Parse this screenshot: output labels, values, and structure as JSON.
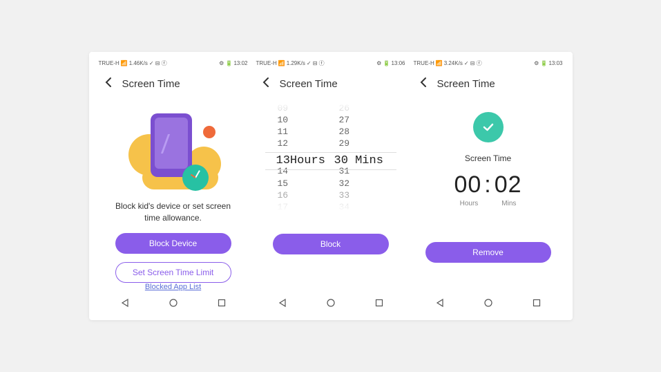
{
  "colors": {
    "primary": "#8a5dea",
    "accent": "#3cc8aa",
    "orange": "#ef6a3a",
    "yellow": "#f6c24a"
  },
  "screens": [
    {
      "status": {
        "carrier": "TRUE-H",
        "speed": "1.46K/s",
        "time": "13:02"
      },
      "header": "Screen Time",
      "body": {
        "description": "Block kid's device or set screen time allowance.",
        "primary_label": "Block Device",
        "secondary_label": "Set Screen Time Limit",
        "link_label": "Blocked App List"
      }
    },
    {
      "status": {
        "carrier": "TRUE-H",
        "speed": "1.29K/s",
        "time": "13:06"
      },
      "header": "Screen Time",
      "body": {
        "picker": {
          "hours_visible": [
            "09",
            "10",
            "11",
            "12",
            "13",
            "14",
            "15",
            "16",
            "17"
          ],
          "mins_visible": [
            "26",
            "27",
            "28",
            "29",
            "30",
            "31",
            "32",
            "33",
            "34"
          ],
          "hours_selected": "13",
          "mins_selected": "30",
          "hours_unit": "Hours",
          "mins_unit": "Mins"
        },
        "primary_label": "Block"
      }
    },
    {
      "status": {
        "carrier": "TRUE-H",
        "speed": "3.24K/s",
        "time": "13:03"
      },
      "header": "Screen Time",
      "body": {
        "title": "Screen Time",
        "hours_value": "00",
        "separator": ":",
        "mins_value": "02",
        "hours_label": "Hours",
        "mins_label": "Mins",
        "primary_label": "Remove"
      }
    }
  ]
}
